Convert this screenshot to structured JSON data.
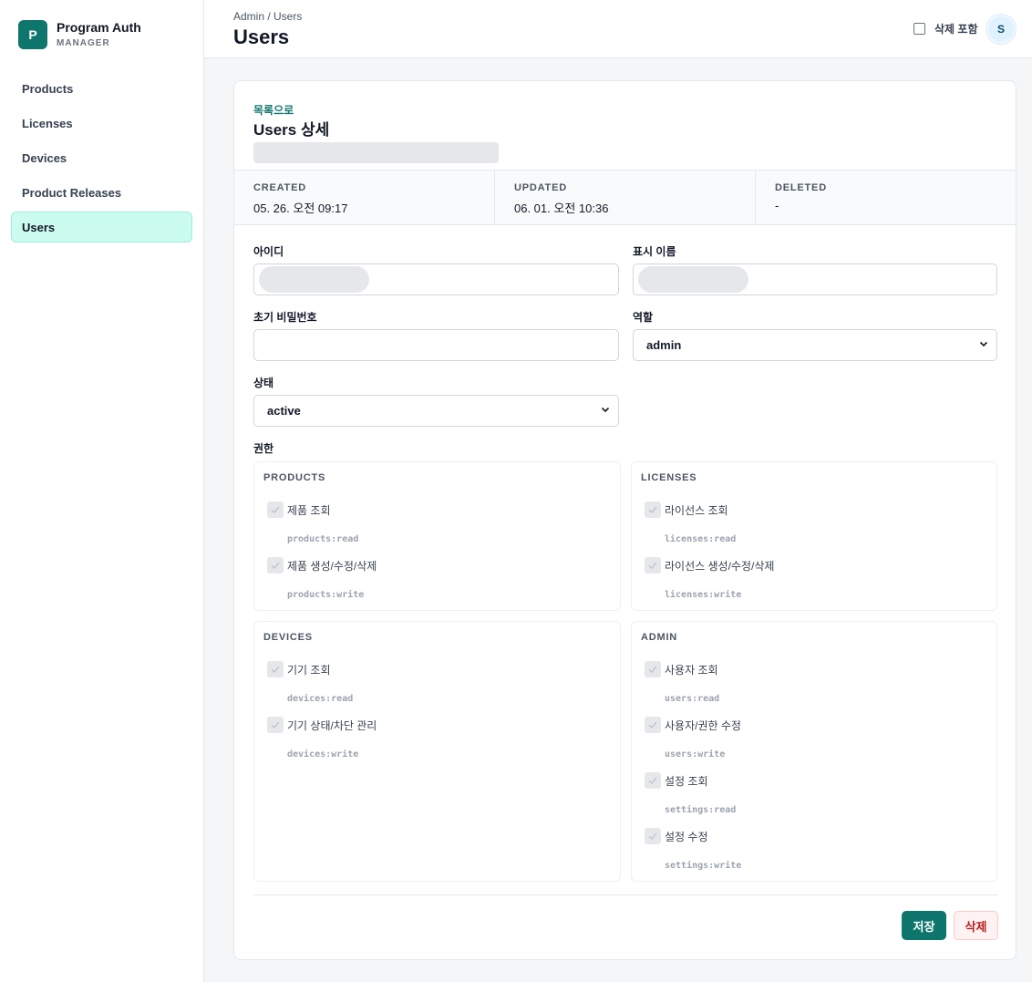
{
  "app": {
    "logo_letter": "P",
    "title": "Program Auth",
    "subtitle": "MANAGER"
  },
  "sidebar": {
    "items": [
      {
        "label": "Products",
        "active": false
      },
      {
        "label": "Licenses",
        "active": false
      },
      {
        "label": "Devices",
        "active": false
      },
      {
        "label": "Product Releases",
        "active": false
      },
      {
        "label": "Users",
        "active": true
      }
    ]
  },
  "header": {
    "breadcrumb": "Admin / Users",
    "title": "Users",
    "include_deleted_label": "삭제 포함",
    "include_deleted_checked": false,
    "avatar_initial": "S"
  },
  "detail": {
    "back_link": "목록으로",
    "title": "Users 상세",
    "meta": [
      {
        "label": "CREATED",
        "value": "05. 26. 오전 09:17"
      },
      {
        "label": "UPDATED",
        "value": "06. 01. 오전 10:36"
      },
      {
        "label": "DELETED",
        "value": "-"
      }
    ],
    "form": {
      "id_label": "아이디",
      "display_name_label": "표시 이름",
      "initial_password_label": "초기 비밀번호",
      "role_label": "역할",
      "role_value": "admin",
      "status_label": "상태",
      "status_value": "active",
      "permissions_label": "권한"
    },
    "permission_groups": [
      {
        "title": "PRODUCTS",
        "items": [
          {
            "label": "제품 조회",
            "code": "products:read",
            "checked": true
          },
          {
            "label": "제품 생성/수정/삭제",
            "code": "products:write",
            "checked": true
          }
        ]
      },
      {
        "title": "LICENSES",
        "items": [
          {
            "label": "라이선스 조회",
            "code": "licenses:read",
            "checked": true
          },
          {
            "label": "라이선스 생성/수정/삭제",
            "code": "licenses:write",
            "checked": true
          }
        ]
      },
      {
        "title": "DEVICES",
        "items": [
          {
            "label": "기기 조회",
            "code": "devices:read",
            "checked": true
          },
          {
            "label": "기기 상태/차단 관리",
            "code": "devices:write",
            "checked": true
          }
        ]
      },
      {
        "title": "ADMIN",
        "items": [
          {
            "label": "사용자 조회",
            "code": "users:read",
            "checked": true
          },
          {
            "label": "사용자/권한 수정",
            "code": "users:write",
            "checked": true
          },
          {
            "label": "설정 조회",
            "code": "settings:read",
            "checked": true
          },
          {
            "label": "설정 수정",
            "code": "settings:write",
            "checked": true
          }
        ]
      }
    ],
    "actions": {
      "save_label": "저장",
      "delete_label": "삭제"
    }
  },
  "colors": {
    "accent": "#0f766e",
    "active_nav_bg": "#ccfbef",
    "danger": "#b91c1c"
  }
}
